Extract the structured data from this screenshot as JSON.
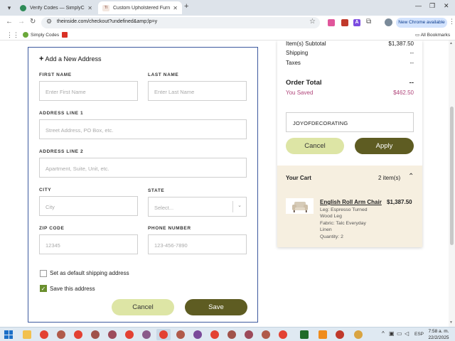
{
  "browser": {
    "tabs": [
      {
        "title": "Verify Codes — SimplyCodes",
        "active": false
      },
      {
        "title": "Custom Upholstered Furniture",
        "active": true
      }
    ],
    "url": "theinside.com/checkout?undefined&amp;lp=y",
    "update_label": "New Chrome available",
    "ext_a_label": "A",
    "bookmarks": [
      {
        "label": "Simply Codes"
      },
      {
        "label": ""
      }
    ],
    "all_bookmarks_label": "All Bookmarks"
  },
  "address_form": {
    "heading": "Add a New Address",
    "first_name": {
      "label": "FIRST NAME",
      "placeholder": "Enter First Name"
    },
    "last_name": {
      "label": "LAST NAME",
      "placeholder": "Enter Last Name"
    },
    "address1": {
      "label": "ADDRESS LINE 1",
      "placeholder": "Street Address, PO Box, etc."
    },
    "address2": {
      "label": "ADDRESS LINE 2",
      "placeholder": "Apartment, Suite, Unit, etc."
    },
    "city": {
      "label": "CITY",
      "placeholder": "City"
    },
    "state": {
      "label": "STATE",
      "placeholder": "Select..."
    },
    "zip": {
      "label": "ZIP CODE",
      "placeholder": "12345"
    },
    "phone": {
      "label": "PHONE NUMBER",
      "placeholder": "123-456-7890"
    },
    "default_shipping_label": "Set as default shipping address",
    "default_shipping_checked": false,
    "save_address_label": "Save this address",
    "save_address_checked": true,
    "cancel_label": "Cancel",
    "save_label": "Save"
  },
  "summary": {
    "subtotal_label": "Item(s) Subtotal",
    "subtotal_value": "$1,387.50",
    "shipping_label": "Shipping",
    "shipping_value": "--",
    "taxes_label": "Taxes",
    "taxes_value": "--",
    "order_total_label": "Order Total",
    "order_total_value": "--",
    "saved_label": "You Saved",
    "saved_value": "$462.50",
    "promo_code": "JOYOFDECORATING",
    "cancel_label": "Cancel",
    "apply_label": "Apply"
  },
  "cart": {
    "title": "Your Cart",
    "count": "2 item(s)",
    "items": [
      {
        "name": "English Roll Arm Chair",
        "price": "$1,387.50",
        "leg_line1": "Leg: Espresso Turned",
        "leg_line2": "Wood Leg",
        "fabric_line1": "Fabric: Talc Everyday",
        "fabric_line2": "Linen",
        "quantity": "Quantity: 2"
      }
    ]
  },
  "taskbar": {
    "language": "ESP",
    "time": "7:58 a. m.",
    "date": "22/2/2025"
  },
  "colors": {
    "accent_dark": "#5e5c22",
    "accent_light": "#dde5a5",
    "saved_pink": "#b0457a",
    "cart_bg": "#f6efe0",
    "form_border": "#3d5a9e"
  }
}
